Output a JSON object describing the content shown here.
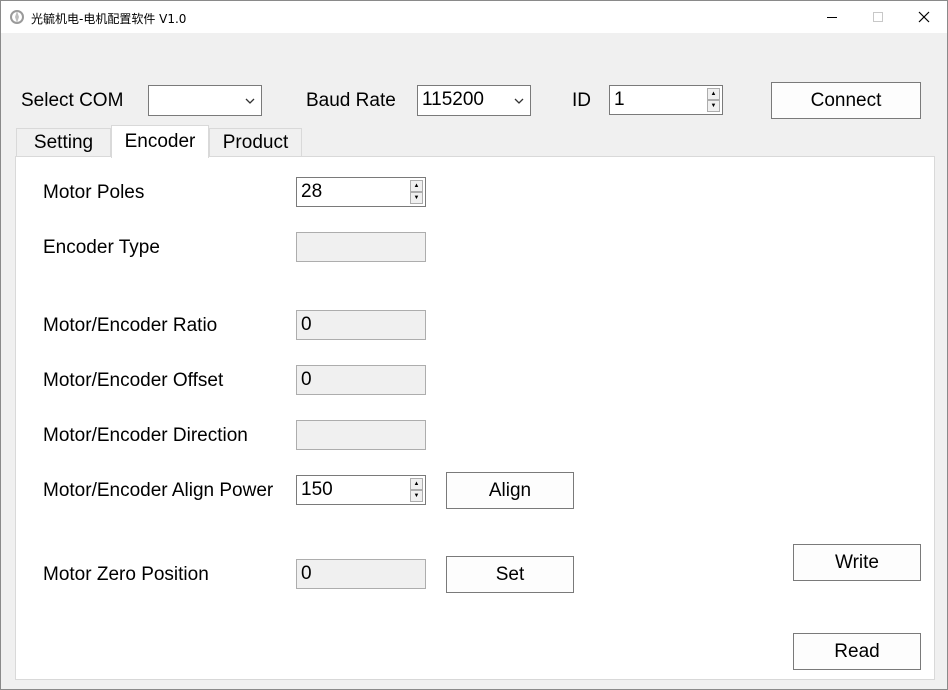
{
  "window": {
    "title": "光毓机电-电机配置软件 V1.0"
  },
  "connection": {
    "select_com_label": "Select COM",
    "select_com_value": "",
    "baud_rate_label": "Baud Rate",
    "baud_rate_value": "115200",
    "id_label": "ID",
    "id_value": "1",
    "connect_label": "Connect"
  },
  "tabs": [
    {
      "label": "Setting",
      "active": false
    },
    {
      "label": "Encoder",
      "active": true
    },
    {
      "label": "Product",
      "active": false
    }
  ],
  "encoder": {
    "motor_poles_label": "Motor Poles",
    "motor_poles_value": "28",
    "encoder_type_label": "Encoder Type",
    "encoder_type_value": "",
    "ratio_label": "Motor/Encoder Ratio",
    "ratio_value": "0",
    "offset_label": "Motor/Encoder Offset",
    "offset_value": "0",
    "direction_label": "Motor/Encoder Direction",
    "direction_value": "",
    "align_power_label": "Motor/Encoder Align Power",
    "align_power_value": "150",
    "align_button": "Align",
    "zero_position_label": "Motor Zero Position",
    "zero_position_value": "0",
    "set_button": "Set",
    "write_button": "Write",
    "read_button": "Read"
  },
  "icons": {
    "app": "app-logo-icon",
    "minimize": "minimize-icon",
    "maximize": "maximize-icon",
    "close": "close-icon",
    "dropdown": "chevron-down-icon",
    "spin_up": "spin-up-icon",
    "spin_down": "spin-down-icon"
  }
}
